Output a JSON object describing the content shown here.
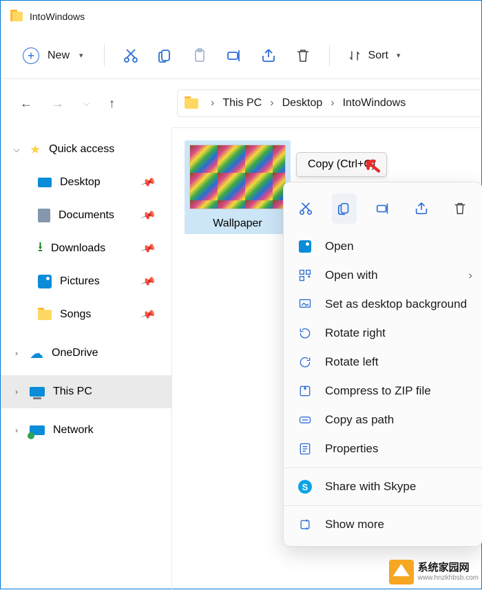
{
  "titlebar": {
    "title": "IntoWindows"
  },
  "toolbar": {
    "new_label": "New",
    "sort_label": "Sort"
  },
  "navigation": {
    "crumb1": "This PC",
    "crumb2": "Desktop",
    "crumb3": "IntoWindows"
  },
  "sidebar": {
    "quick_access": "Quick access",
    "desktop": "Desktop",
    "documents": "Documents",
    "downloads": "Downloads",
    "pictures": "Pictures",
    "songs": "Songs",
    "onedrive": "OneDrive",
    "this_pc": "This PC",
    "network": "Network"
  },
  "file": {
    "name": "Wallpaper"
  },
  "tooltip": {
    "text": "Copy (Ctrl+C)"
  },
  "context_menu": {
    "open": "Open",
    "open_with": "Open with",
    "set_bg": "Set as desktop background",
    "rotate_right": "Rotate right",
    "rotate_left": "Rotate left",
    "compress": "Compress to ZIP file",
    "copy_path": "Copy as path",
    "properties": "Properties",
    "share_skype": "Share with Skype",
    "show_more": "Show more"
  },
  "watermark": {
    "line1": "系统家园网",
    "line2": "www.hnzkhbsb.com"
  }
}
